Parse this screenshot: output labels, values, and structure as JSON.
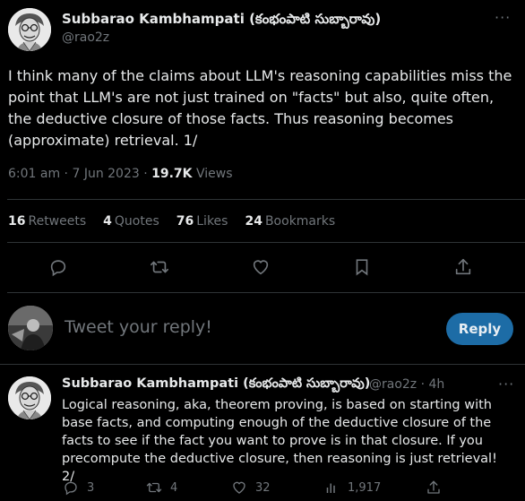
{
  "tweet": {
    "author_name": "Subbarao Kambhampati (కంభంపాటి సుబ్బారావు)",
    "handle": "@rao2z",
    "text": "I think many of the claims about LLM's reasoning capabilities miss the point that LLM's are not just trained on \"facts\" but also, quite often, the deductive closure of those facts. Thus reasoning becomes (approximate) retrieval. 1/",
    "time": "6:01 am · 7 Jun 2023 · ",
    "views_count": "19.7K",
    "views_label": "Views",
    "stats": {
      "retweets_count": "16",
      "retweets_label": "Retweets",
      "quotes_count": "4",
      "quotes_label": "Quotes",
      "likes_count": "76",
      "likes_label": "Likes",
      "bookmarks_count": "24",
      "bookmarks_label": "Bookmarks"
    }
  },
  "reply_box": {
    "placeholder": "Tweet your reply!",
    "button_label": "Reply"
  },
  "reply_tweet": {
    "author_name": "Subbarao Kambhampati (కంభంపాటి సుబ్బారావు)",
    "handle_time": "@rao2z · 4h",
    "text": "Logical reasoning, aka, theorem proving, is based on starting with base facts, and computing enough of the deductive closure of the facts to see if the fact you want to prove is in that closure. If you precompute the deductive closure, then reasoning is just retrieval! 2/",
    "replies": "3",
    "retweets": "4",
    "likes": "32",
    "views": "1,917"
  },
  "colors": {
    "background": "#000000",
    "text": "#e7e9ea",
    "muted": "#71767b",
    "divider": "#2f3336",
    "reply_button": "#1d6ca6"
  }
}
